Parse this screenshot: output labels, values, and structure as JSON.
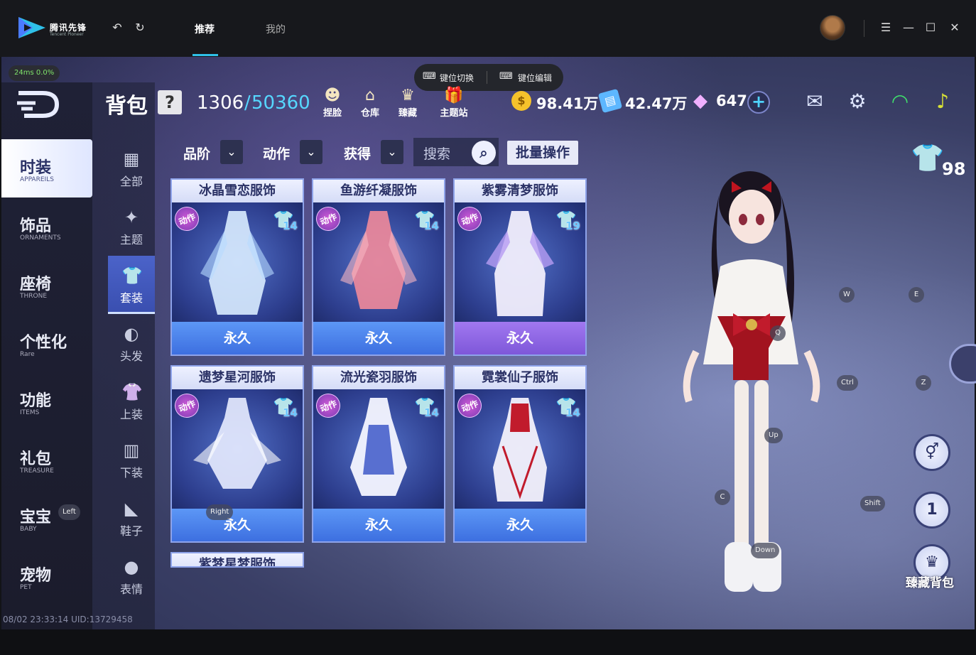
{
  "launcher": {
    "brand": "腾讯先锋",
    "brand_en": "Tencent Pioneer",
    "tabs": [
      {
        "label": "推荐",
        "active": true
      },
      {
        "label": "我的",
        "active": false
      }
    ],
    "ping": "24ms 0.0%",
    "keybar": {
      "switch": "键位切换",
      "edit": "键位编辑"
    }
  },
  "header": {
    "title": "背包",
    "help": "?",
    "capacity_current": "1306",
    "capacity_sep": "/",
    "capacity_max": "50360",
    "buttons": [
      "捏脸",
      "仓库",
      "臻藏",
      "主题站"
    ],
    "currency": [
      {
        "icon": "coin-icon",
        "value": "98.41万",
        "color": "#f5c22b"
      },
      {
        "icon": "ticket-icon",
        "value": "42.47万",
        "color": "#5db7ff"
      },
      {
        "icon": "diamond-icon",
        "value": "647",
        "color": "#e08cff"
      }
    ]
  },
  "left_nav": [
    {
      "cn": "时装",
      "en": "APPAREILS",
      "active": true
    },
    {
      "cn": "饰品",
      "en": "ORNAMENTS",
      "active": false
    },
    {
      "cn": "座椅",
      "en": "THRONE",
      "active": false
    },
    {
      "cn": "个性化",
      "en": "Rare",
      "active": false
    },
    {
      "cn": "功能",
      "en": "ITEMS",
      "active": false
    },
    {
      "cn": "礼包",
      "en": "TREASURE",
      "active": false
    },
    {
      "cn": "宝宝",
      "en": "BABY",
      "active": false
    },
    {
      "cn": "宠物",
      "en": "PET",
      "active": false
    }
  ],
  "sub_nav": [
    {
      "label": "全部",
      "icon": "grid-icon",
      "active": false
    },
    {
      "label": "主题",
      "icon": "star-wand-icon",
      "active": false
    },
    {
      "label": "套装",
      "icon": "outfit-icon",
      "active": true
    },
    {
      "label": "头发",
      "icon": "hair-icon",
      "active": false
    },
    {
      "label": "上装",
      "icon": "top-icon",
      "active": false
    },
    {
      "label": "下装",
      "icon": "pants-icon",
      "active": false
    },
    {
      "label": "鞋子",
      "icon": "shoe-icon",
      "active": false
    },
    {
      "label": "表情",
      "icon": "face-icon",
      "active": false
    }
  ],
  "filters": {
    "grade": "品阶",
    "action": "动作",
    "obtain": "获得",
    "search_placeholder": "搜索",
    "bulk": "批量操作"
  },
  "items": [
    {
      "name": "冰晶雪恋服饰",
      "badge": "动作",
      "count": "14",
      "status": "永久",
      "color": "blue"
    },
    {
      "name": "鱼游纤凝服饰",
      "badge": "动作",
      "count": "14",
      "status": "永久",
      "color": "blue"
    },
    {
      "name": "紫雾清梦服饰",
      "badge": "动作",
      "count": "19",
      "status": "永久",
      "color": "purple"
    },
    {
      "name": "遗梦星河服饰",
      "badge": "动作",
      "count": "14",
      "status": "永久",
      "color": "blue"
    },
    {
      "name": "流光瓷羽服饰",
      "badge": "动作",
      "count": "14",
      "status": "永久",
      "color": "blue"
    },
    {
      "name": "霓裳仙子服饰",
      "badge": "动作",
      "count": "14",
      "status": "永久",
      "color": "blue"
    },
    {
      "name": "紫梦星梦服饰"
    }
  ],
  "character": {
    "shirt_count": "98",
    "key_hints": [
      "W",
      "E",
      "Q",
      "Ctrl",
      "Z",
      "Up",
      "C",
      "Shift",
      "Down",
      "Left",
      "Right"
    ],
    "treasure_bag": "臻藏背包",
    "outfit_slot_num": "1"
  },
  "footer": {
    "info": "08/02 23:33:14 UID:13729458"
  }
}
